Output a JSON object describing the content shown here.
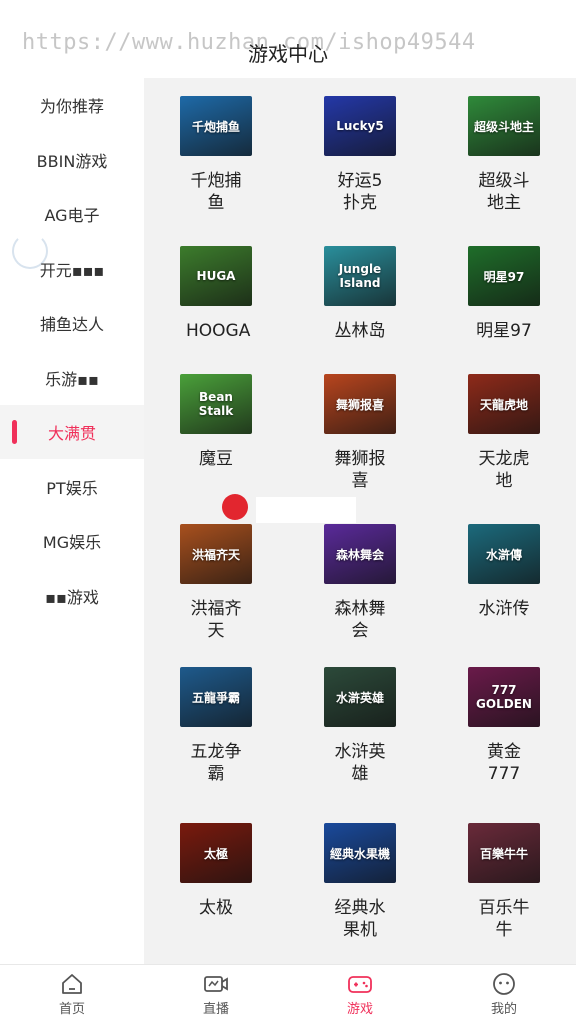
{
  "header": {
    "title": "游戏中心",
    "watermark": "https://www.huzhan.com/ishop49544"
  },
  "sidebar": {
    "items": [
      {
        "label": "为你推荐"
      },
      {
        "label": "BBIN游戏"
      },
      {
        "label": "AG电子"
      },
      {
        "label": "开元▪▪▪"
      },
      {
        "label": "捕鱼达人"
      },
      {
        "label": "乐游▪▪"
      },
      {
        "label": "大满贯",
        "active": true
      },
      {
        "label": "PT娱乐"
      },
      {
        "label": "MG娱乐"
      },
      {
        "label": "▪▪游戏"
      }
    ]
  },
  "games": [
    {
      "name": "千炮捕鱼",
      "icon_text": "千炮捕鱼",
      "color": "#1e6aa8"
    },
    {
      "name": "好运5扑克",
      "icon_text": "Lucky5",
      "color": "#2438a8"
    },
    {
      "name": "超级斗地主",
      "icon_text": "超级斗地主",
      "color": "#2f8a3a"
    },
    {
      "name": "HOOGA",
      "icon_text": "HUGA",
      "color": "#3c7c2c"
    },
    {
      "name": "丛林岛",
      "icon_text": "Jungle Island",
      "color": "#2a8f9c"
    },
    {
      "name": "明星97",
      "icon_text": "明星97",
      "color": "#1f6e2a"
    },
    {
      "name": "魔豆",
      "icon_text": "Bean Stalk",
      "color": "#4aa03a"
    },
    {
      "name": "舞狮报喜",
      "icon_text": "舞狮报喜",
      "color": "#b8451e"
    },
    {
      "name": "天龙虎地",
      "icon_text": "天龍虎地",
      "color": "#8e2a1a"
    },
    {
      "name": "洪福齐天",
      "icon_text": "洪福齐天",
      "color": "#a8501e"
    },
    {
      "name": "森林舞会",
      "icon_text": "森林舞会",
      "color": "#5a2a9a"
    },
    {
      "name": "水浒传",
      "icon_text": "水滸傳",
      "color": "#1c6a7c"
    },
    {
      "name": "五龙争霸",
      "icon_text": "五龍爭霸",
      "color": "#1e5a8c"
    },
    {
      "name": "水浒英雄",
      "icon_text": "水滸英雄",
      "color": "#2c4a3a"
    },
    {
      "name": "黄金777",
      "icon_text": "777 GOLDEN",
      "color": "#6a1a4a"
    },
    {
      "name": "太极",
      "icon_text": "太極",
      "color": "#7a1a0e"
    },
    {
      "name": "经典水果机",
      "icon_text": "經典水果機",
      "color": "#1a4a9c"
    },
    {
      "name": "百乐牛牛",
      "icon_text": "百樂牛牛",
      "color": "#6a2a3a"
    }
  ],
  "tabbar": {
    "tabs": [
      {
        "label": "首页"
      },
      {
        "label": "直播"
      },
      {
        "label": "游戏",
        "active": true
      },
      {
        "label": "我的"
      }
    ]
  },
  "colors": {
    "accent": "#f0305a",
    "content_bg": "#f2f2f2"
  }
}
